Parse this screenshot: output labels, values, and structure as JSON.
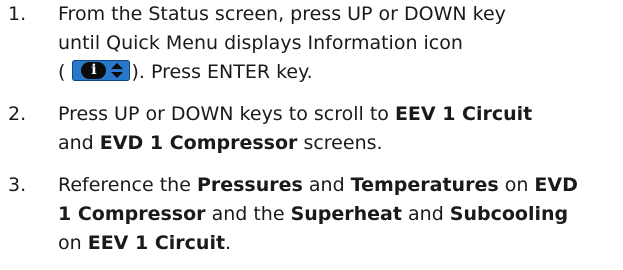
{
  "steps": [
    {
      "number": "1.",
      "line1": "From the Status screen, press UP or DOWN key",
      "line2": "until Quick Menu displays Information icon",
      "line3_pre": "(",
      "icon": "information-icon",
      "icon_letter": "i",
      "line3_post": "). Press ENTER key."
    },
    {
      "number": "2.",
      "line1_pre": "Press UP or DOWN keys to scroll to ",
      "line1_b1": "EEV 1 Circuit",
      "line2_pre": "and ",
      "line2_b1": "EVD 1 Compressor",
      "line2_post": " screens."
    },
    {
      "number": "3.",
      "line1_pre": "Reference the ",
      "line1_b1": "Pressures",
      "line1_mid": " and ",
      "line1_b2": "Temperatures",
      "line1_mid2": " on ",
      "line1_b3": "EVD",
      "line2_b1": "1 Compressor",
      "line2_mid": " and the ",
      "line2_b2": "Superheat",
      "line2_mid2": " and ",
      "line2_b3": "Subcooling",
      "line3_pre": "on ",
      "line3_b1": "EEV 1 Circuit",
      "line3_post": "."
    }
  ],
  "colors": {
    "text": "#1a1a1a",
    "icon_background": "#2a78cc",
    "icon_circle": "#0b0b0b"
  }
}
